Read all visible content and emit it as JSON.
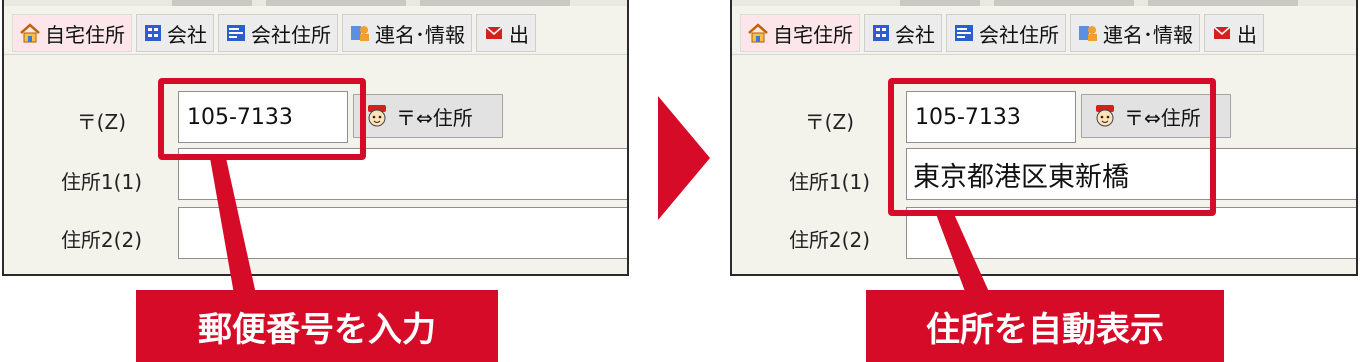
{
  "tabs": [
    {
      "label": "自宅住所",
      "icon": "house-icon"
    },
    {
      "label": "会社",
      "icon": "company-icon"
    },
    {
      "label": "会社住所",
      "icon": "company-address-icon"
    },
    {
      "label": "連名･情報",
      "icon": "people-icon"
    },
    {
      "label": "出",
      "icon": "mail-out-icon"
    }
  ],
  "form": {
    "postal_label": "〒(Z)",
    "address1_label": "住所1(1)",
    "address2_label": "住所2(2)",
    "lookup_button_label": "〒⇔住所"
  },
  "before": {
    "postal_code": "105-7133",
    "address1": "",
    "address2": "",
    "caption": "郵便番号を入力"
  },
  "after": {
    "postal_code": "105-7133",
    "address1": "東京都港区東新橋",
    "address2": "",
    "caption": "住所を自動表示"
  },
  "colors": {
    "highlight": "#d50b27",
    "active_tab": "#fde6ea",
    "panel_bg": "#f3f3eb"
  }
}
